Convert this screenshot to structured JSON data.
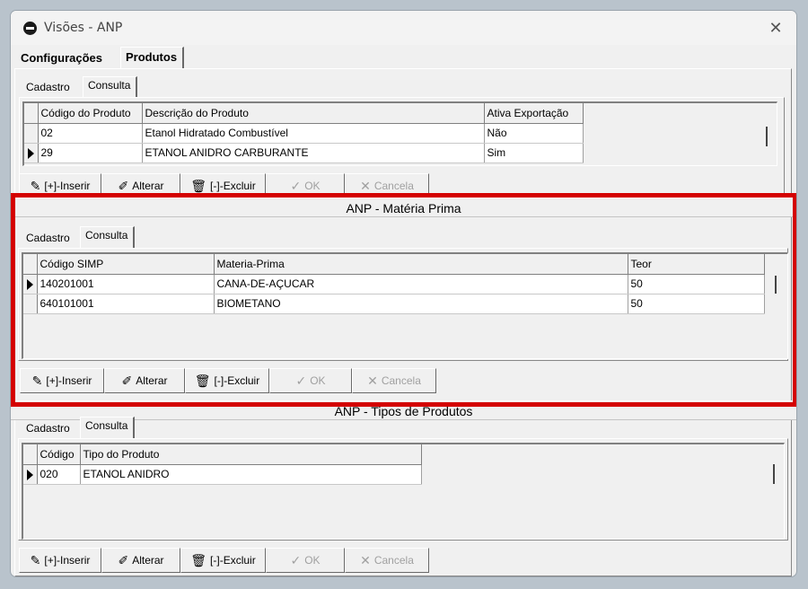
{
  "window": {
    "title": "Visões - ANP"
  },
  "main_tabs": [
    "Configurações",
    "Produtos"
  ],
  "produtos": {
    "subtabs": [
      "Cadastro",
      "Consulta"
    ],
    "columns": [
      "Código do Produto",
      "Descrição do Produto",
      "Ativa Exportação"
    ],
    "rows": [
      [
        "02",
        "Etanol Hidratado Combustível",
        "Não"
      ],
      [
        "29",
        "ETANOL ANIDRO CARBURANTE",
        "Sim"
      ]
    ]
  },
  "materia_prima": {
    "title": "ANP - Matéria Prima",
    "subtabs": [
      "Cadastro",
      "Consulta"
    ],
    "columns": [
      "Código SIMP",
      "Materia-Prima",
      "Teor"
    ],
    "rows": [
      [
        "140201001",
        "CANA-DE-AÇUCAR",
        "50"
      ],
      [
        "640101001",
        "BIOMETANO",
        "50"
      ]
    ]
  },
  "tipos_produtos": {
    "title": "ANP - Tipos de Produtos",
    "subtabs": [
      "Cadastro",
      "Consulta"
    ],
    "columns": [
      "Código",
      "Tipo do Produto"
    ],
    "rows": [
      [
        "020",
        "ETANOL ANIDRO"
      ]
    ]
  },
  "buttons": {
    "inserir": "[+]-Inserir",
    "alterar": "Alterar",
    "excluir": "[-]-Excluir",
    "ok": "OK",
    "cancela": "Cancela"
  },
  "colors": {
    "highlight": "#d40000"
  }
}
